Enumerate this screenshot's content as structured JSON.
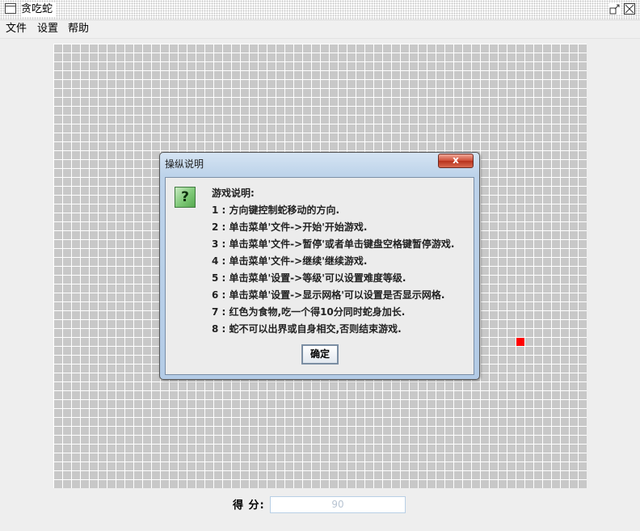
{
  "window": {
    "title": "贪吃蛇",
    "app_icon": "window-icon",
    "restore_icon": "restore-icon",
    "close_icon": "close-icon"
  },
  "menu": {
    "items": [
      {
        "label": "文件"
      },
      {
        "label": "设置"
      },
      {
        "label": "帮助"
      }
    ]
  },
  "board": {
    "columns": 60,
    "rows": 50,
    "grid_visible": true,
    "grid_color": "#ffffff",
    "cell_color": "#c8c8c8",
    "food": {
      "col": 52,
      "row": 33,
      "color": "#ff0000"
    }
  },
  "score": {
    "label": "得 分:",
    "value": "90"
  },
  "dialog": {
    "title": "操纵说明",
    "close_label": "x",
    "icon_glyph": "?",
    "message_lines": [
      "游戏说明:",
      "1 : 方向键控制蛇移动的方向.",
      "2 : 单击菜单'文件->开始'开始游戏.",
      "3 : 单击菜单'文件->暂停'或者单击键盘空格键暂停游戏.",
      "4 : 单击菜单'文件->继续'继续游戏.",
      "5 : 单击菜单'设置->等级'可以设置难度等级.",
      "6 : 单击菜单'设置->显示网格'可以设置是否显示网格.",
      "7 : 红色为食物,吃一个得10分同时蛇身加长.",
      "8 : 蛇不可以出界或自身相交,否则结束游戏."
    ],
    "ok_label": "确定"
  }
}
